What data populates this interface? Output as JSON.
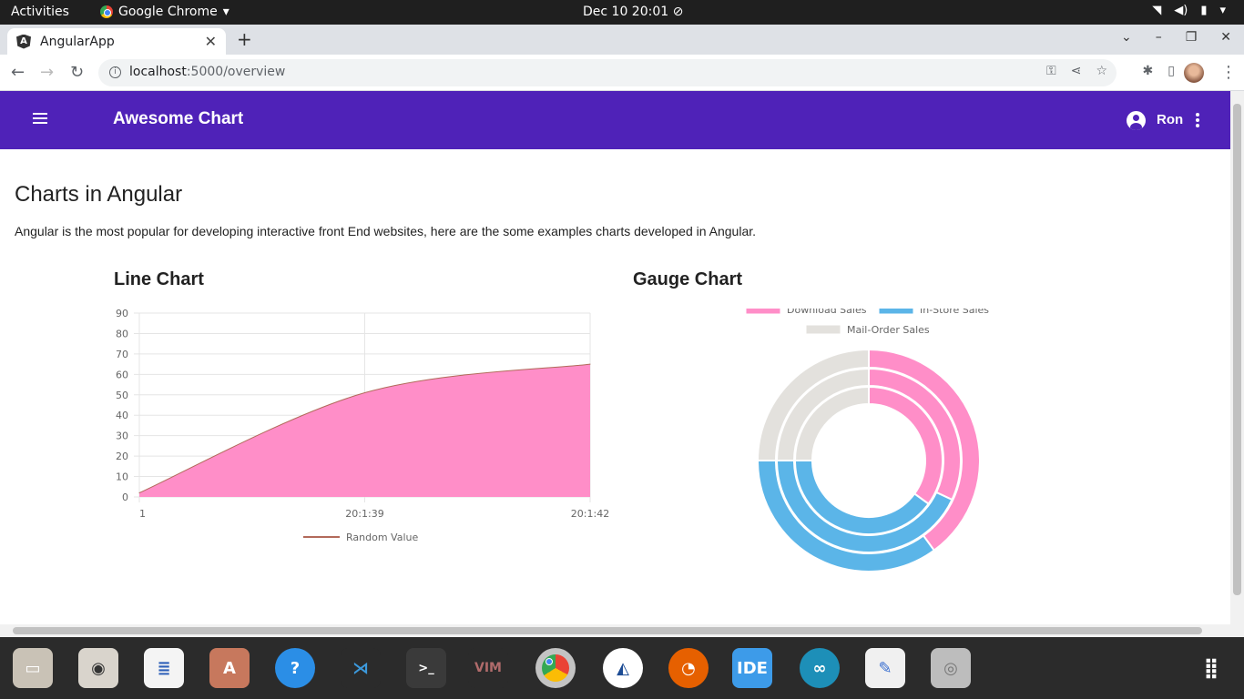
{
  "os_topbar": {
    "activities": "Activities",
    "app_name": "Google Chrome",
    "clock": "Dec 10  20:01"
  },
  "browser": {
    "tab_title": "AngularApp",
    "url_host": "localhost",
    "url_path": ":5000/overview"
  },
  "app": {
    "title": "Awesome Chart",
    "user": "Ron",
    "heading": "Charts in Angular",
    "intro": "Angular is the most popular for developing interactive front End websites, here are the some examples charts developed in Angular."
  },
  "chart_data": [
    {
      "type": "area",
      "title": "Line Chart",
      "x": [
        "1",
        "20:1:39",
        "20:1:42"
      ],
      "series": [
        {
          "name": "Random Value",
          "values": [
            2,
            51,
            65
          ],
          "color": "#ff8ec8",
          "line_color": "#b26a5a"
        }
      ],
      "yticks": [
        0,
        10,
        20,
        30,
        40,
        50,
        60,
        70,
        80,
        90
      ],
      "ylim": [
        0,
        90
      ],
      "grid": true,
      "legend": "bottom"
    },
    {
      "type": "pie",
      "title": "Gauge Chart",
      "legend": "top",
      "labels": [
        "Download Sales",
        "In-Store Sales",
        "Mail-Order Sales"
      ],
      "colors": [
        "#ff8ec8",
        "#5bb5e8",
        "#e3e1dd"
      ],
      "rings": [
        {
          "values": [
            40,
            35,
            25
          ]
        },
        {
          "values": [
            32,
            43,
            25
          ]
        },
        {
          "values": [
            35,
            40,
            25
          ]
        }
      ]
    }
  ],
  "dock": {
    "ide_label": "IDE"
  }
}
